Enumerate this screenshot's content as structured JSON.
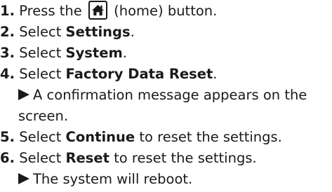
{
  "steps": [
    {
      "num": "1.",
      "before": "Press the",
      "icon": "home-icon",
      "after": "(home) button."
    },
    {
      "num": "2.",
      "before": "Select ",
      "bold": "Settings",
      "after": "."
    },
    {
      "num": "3.",
      "before": "Select ",
      "bold": "System",
      "after": "."
    },
    {
      "num": "4.",
      "before": "Select ",
      "bold": "Factory Data Reset",
      "after": "."
    },
    {
      "num": "5.",
      "before": "Select ",
      "bold": "Continue",
      "after": " to reset the settings."
    },
    {
      "num": "6.",
      "before": "Select ",
      "bold": "Reset",
      "after": " to reset the settings."
    }
  ],
  "results": [
    {
      "line1": "A confirmation message appears on the",
      "line2": "screen."
    },
    {
      "line1": "The system will reboot."
    }
  ]
}
